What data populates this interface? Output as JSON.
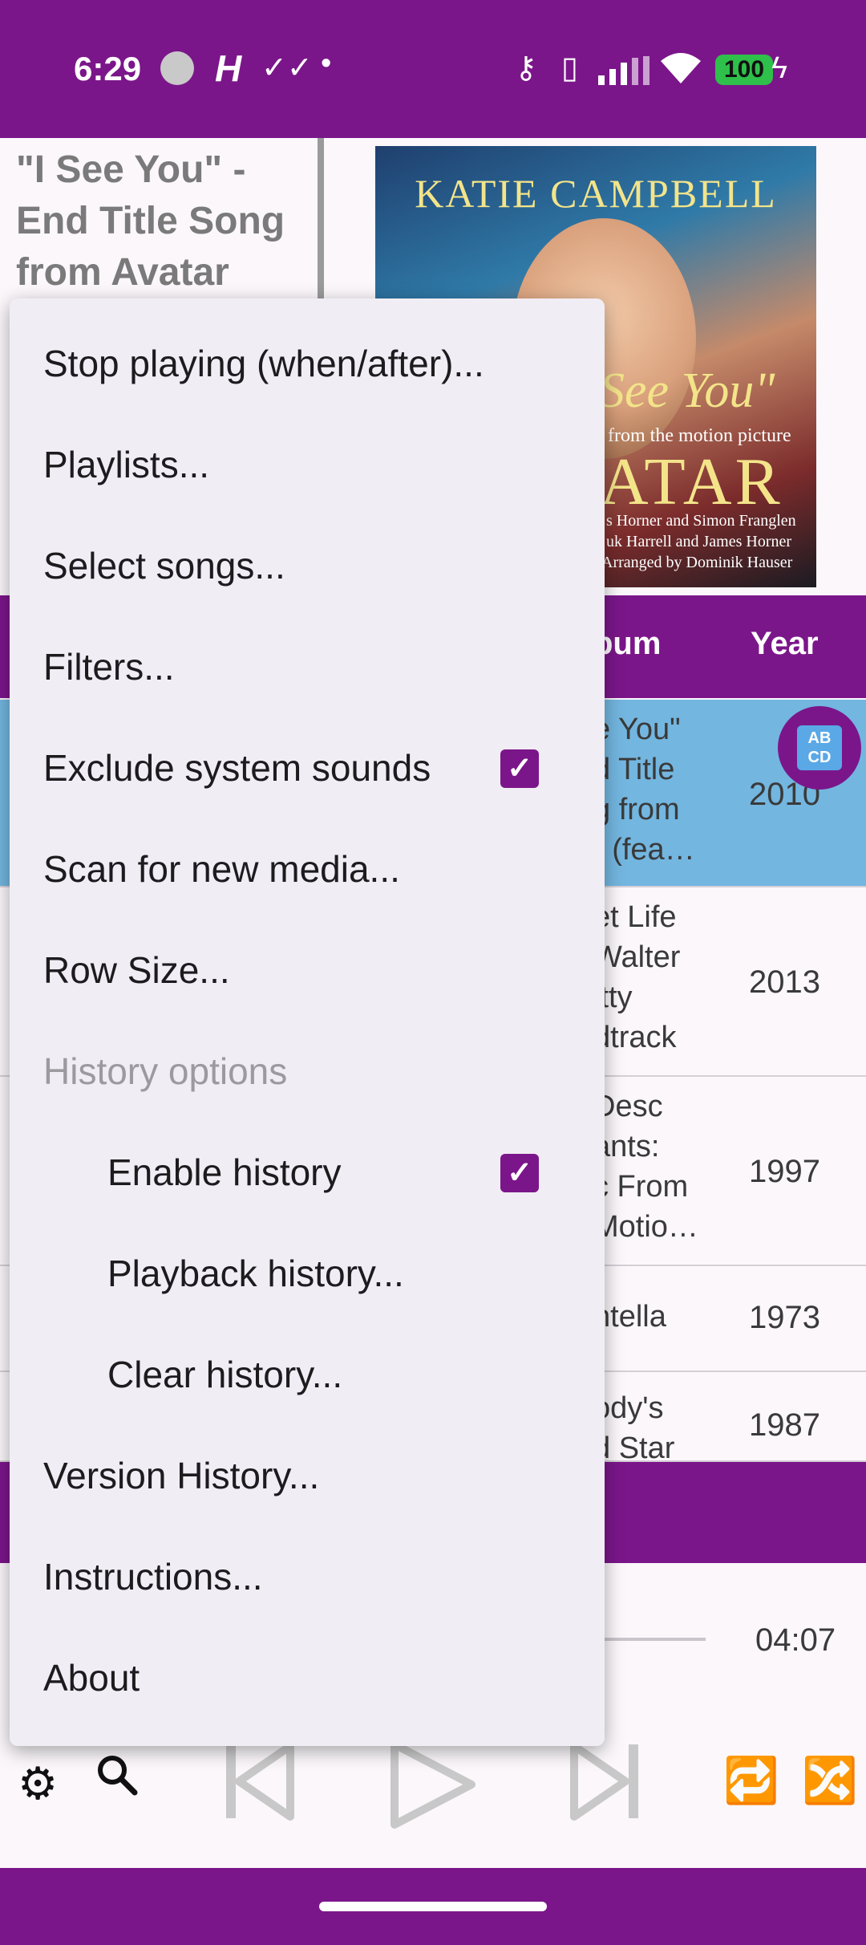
{
  "status_bar": {
    "time": "6:29",
    "battery": "100",
    "icons": [
      "avatar-icon",
      "h-app-icon",
      "double-check-icon",
      "dot-icon",
      "vpn-key-icon",
      "vibrate-icon",
      "signal-icon",
      "wifi-icon",
      "battery-icon",
      "charging-icon"
    ]
  },
  "now_playing": {
    "title": "\"I See You\" - End Title Song from Avatar",
    "album_art": {
      "artist_text": "KATIE CAMPBELL",
      "song_text": "See You\"",
      "subtitle_text": "from the motion picture",
      "movie_text": "ATAR",
      "credits": [
        "s Horner and Simon Franglen",
        "uk Harrell and James Horner",
        "Arranged by Dominik Hauser"
      ]
    }
  },
  "list": {
    "columns": {
      "album": "bum",
      "year": "Year"
    },
    "rows": [
      {
        "album_lines": [
          "e You\"",
          "d Title",
          "g from",
          "r (fea…"
        ],
        "year": "2010",
        "selected": true
      },
      {
        "album_lines": [
          "et Life",
          "Walter",
          "itty",
          "dtrack"
        ],
        "year": "2013",
        "selected": false
      },
      {
        "album_lines": [
          " Desc",
          "ants:",
          "c From",
          "Motio…"
        ],
        "year": "1997",
        "selected": false
      },
      {
        "album_lines": [
          "ntella"
        ],
        "year": "1973",
        "selected": false
      },
      {
        "album_lines": [
          "ody's",
          "d Star"
        ],
        "year": "1987",
        "selected": false
      }
    ],
    "fab_label": "AB CD"
  },
  "player": {
    "duration": "04:07",
    "controls": [
      "settings-icon",
      "search-icon",
      "previous-icon",
      "play-icon",
      "next-icon",
      "repeat-icon",
      "shuffle-icon"
    ]
  },
  "menu": {
    "items": [
      {
        "label": "Stop playing (when/after)..."
      },
      {
        "label": "Playlists..."
      },
      {
        "label": "Select songs..."
      },
      {
        "label": "Filters..."
      },
      {
        "label": "Exclude system sounds",
        "checked": true
      },
      {
        "label": "Scan for new media..."
      },
      {
        "label": "Row Size..."
      },
      {
        "label": "History options",
        "disabled": true
      },
      {
        "label": "Enable history",
        "checked": true,
        "indent": true
      },
      {
        "label": "Playback history...",
        "indent": true
      },
      {
        "label": "Clear history...",
        "indent": true
      },
      {
        "label": "Version History..."
      },
      {
        "label": "Instructions..."
      },
      {
        "label": "About"
      }
    ],
    "check_glyph": "✓"
  },
  "colors": {
    "primary": "#7b168a",
    "selected_row": "#73b6e0",
    "menu_bg": "#f1edf4",
    "battery_green": "#2ec04a"
  }
}
